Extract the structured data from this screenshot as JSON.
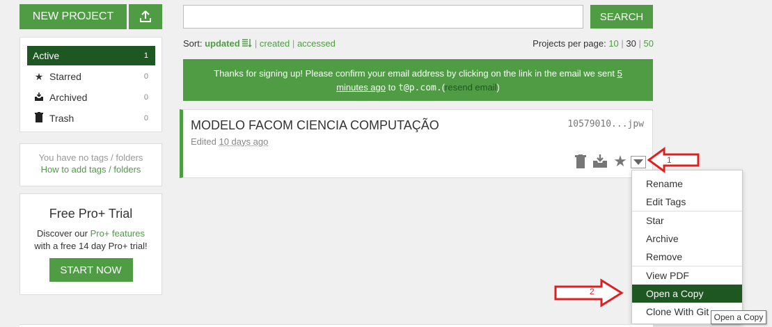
{
  "header": {
    "new_project_label": "NEW PROJECT",
    "search_placeholder": "",
    "search_label": "SEARCH"
  },
  "sidebar": {
    "items": [
      {
        "label": "Active",
        "count": "1",
        "icon": "none"
      },
      {
        "label": "Starred",
        "count": "0",
        "icon": "star-icon"
      },
      {
        "label": "Archived",
        "count": "0",
        "icon": "archive-icon"
      },
      {
        "label": "Trash",
        "count": "0",
        "icon": "trash-icon"
      }
    ],
    "tags_empty": "You have no tags / folders",
    "tags_help": "How to add tags / folders"
  },
  "trial": {
    "title": "Free Pro+ Trial",
    "line1_prefix": "Discover our ",
    "line1_link": "Pro+ features",
    "line2": "with a free 14 day Pro+ trial!",
    "button": "START NOW"
  },
  "sort": {
    "label": "Sort:",
    "updated": "updated",
    "created": "created",
    "accessed": "accessed",
    "per_page_label": "Projects per page:",
    "opt10": "10",
    "opt30": "30",
    "opt50": "50"
  },
  "banner": {
    "text1": "Thanks for signing up! Please confirm your email address by clicking on the link in the email we sent ",
    "ago_a": "5",
    "ago_b": "minutes ago",
    "to": " to ",
    "email": "t@p.com.",
    "paren_open": "(",
    "resend": "resend email",
    "paren_close": ")"
  },
  "project": {
    "title": "MODELO FACOM CIENCIA COMPUTAÇÃO",
    "id": "10579010...jpw",
    "edited_prefix": "Edited ",
    "edited_when": "10 days ago"
  },
  "menu": {
    "rename": "Rename",
    "edit_tags": "Edit Tags",
    "star": "Star",
    "archive": "Archive",
    "remove": "Remove",
    "view_pdf": "View PDF",
    "open_copy": "Open a Copy",
    "clone_git": "Clone With Git"
  },
  "annotations": {
    "arrow1": "1",
    "arrow2": "2"
  },
  "tooltip": "Open a Copy",
  "colors": {
    "accent": "#4f9c45",
    "dark_accent": "#1f5722",
    "annotation_red": "#e02020"
  }
}
